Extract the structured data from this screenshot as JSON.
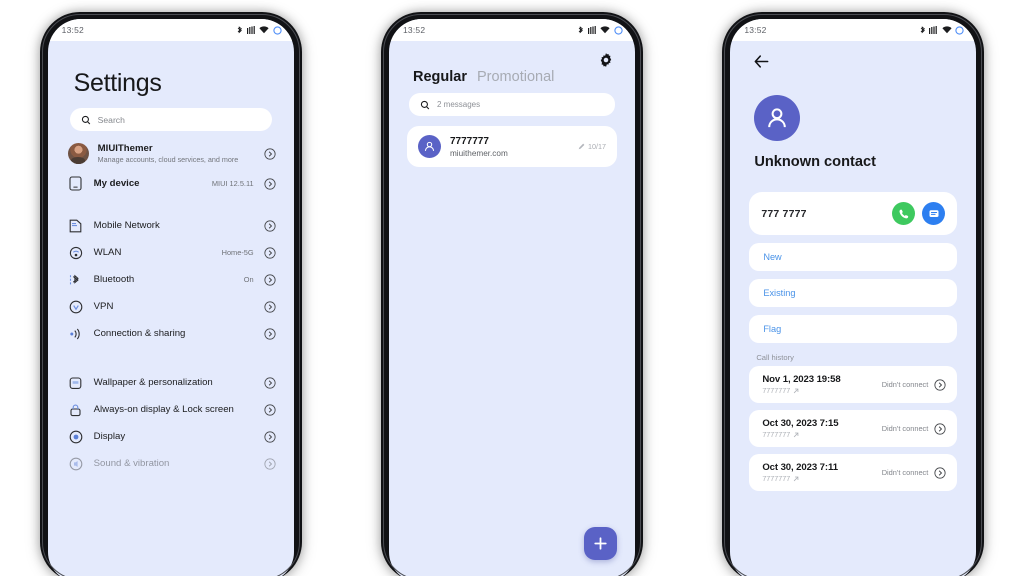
{
  "status_bar": {
    "time": "13:52",
    "icons": [
      "bluetooth-icon",
      "signal-icon",
      "wifi-icon",
      "battery-icon"
    ]
  },
  "phone1": {
    "screen_name": "Settings",
    "title": "Settings",
    "search": {
      "placeholder": "Search",
      "icon": "search-icon"
    },
    "account": {
      "name": "MIUIThemer",
      "subtitle": "Manage accounts, cloud services, and more",
      "avatar": "user-photo-avatar"
    },
    "device": {
      "label": "My device",
      "value": "MIUI 12.5.11",
      "icon": "device-icon"
    },
    "groups": [
      {
        "items": [
          {
            "label": "Mobile Network",
            "value": "",
            "icon": "sim-card-icon"
          },
          {
            "label": "WLAN",
            "value": "Home-5G",
            "icon": "wifi-settings-icon"
          },
          {
            "label": "Bluetooth",
            "value": "On",
            "icon": "bluetooth-settings-icon"
          },
          {
            "label": "VPN",
            "value": "",
            "icon": "vpn-icon"
          },
          {
            "label": "Connection & sharing",
            "value": "",
            "icon": "connection-sharing-icon"
          }
        ]
      },
      {
        "items": [
          {
            "label": "Wallpaper & personalization",
            "value": "",
            "icon": "wallpaper-icon"
          },
          {
            "label": "Always-on display & Lock screen",
            "value": "",
            "icon": "lock-icon"
          },
          {
            "label": "Display",
            "value": "",
            "icon": "display-icon"
          },
          {
            "label": "Sound & vibration",
            "value": "",
            "icon": "sound-icon"
          }
        ]
      }
    ]
  },
  "phone2": {
    "screen_name": "Messages",
    "settings_icon": "gear-icon",
    "tabs": [
      {
        "label": "Regular",
        "active": true
      },
      {
        "label": "Promotional",
        "active": false
      }
    ],
    "search": {
      "placeholder": "2 messages",
      "icon": "search-icon"
    },
    "messages": [
      {
        "sender": "7777777",
        "preview": "miuithemer.com",
        "date": "10/17",
        "meta_icon": "pencil-icon",
        "avatar": "person-avatar"
      }
    ],
    "fab": {
      "icon": "plus-icon",
      "color": "#5a62c6"
    }
  },
  "phone3": {
    "screen_name": "Contact details",
    "back_icon": "back-arrow-icon",
    "avatar": "person-avatar",
    "contact_name": "Unknown contact",
    "phone_number": "777 7777",
    "call_button": {
      "icon": "phone-icon",
      "color": "#3ec95f"
    },
    "message_button": {
      "icon": "message-icon",
      "color": "#2d7ff0"
    },
    "actions": [
      {
        "label": "New"
      },
      {
        "label": "Existing"
      },
      {
        "label": "Flag"
      }
    ],
    "call_history_label": "Call history",
    "call_history": [
      {
        "date": "Nov 1, 2023 19:58",
        "number": "7777777",
        "status": "Didn't connect",
        "direction_icon": "outgoing-call-icon"
      },
      {
        "date": "Oct 30, 2023 7:15",
        "number": "7777777",
        "status": "Didn't connect",
        "direction_icon": "outgoing-call-icon"
      },
      {
        "date": "Oct 30, 2023 7:11",
        "number": "7777777",
        "status": "Didn't connect",
        "direction_icon": "outgoing-call-icon"
      }
    ]
  }
}
